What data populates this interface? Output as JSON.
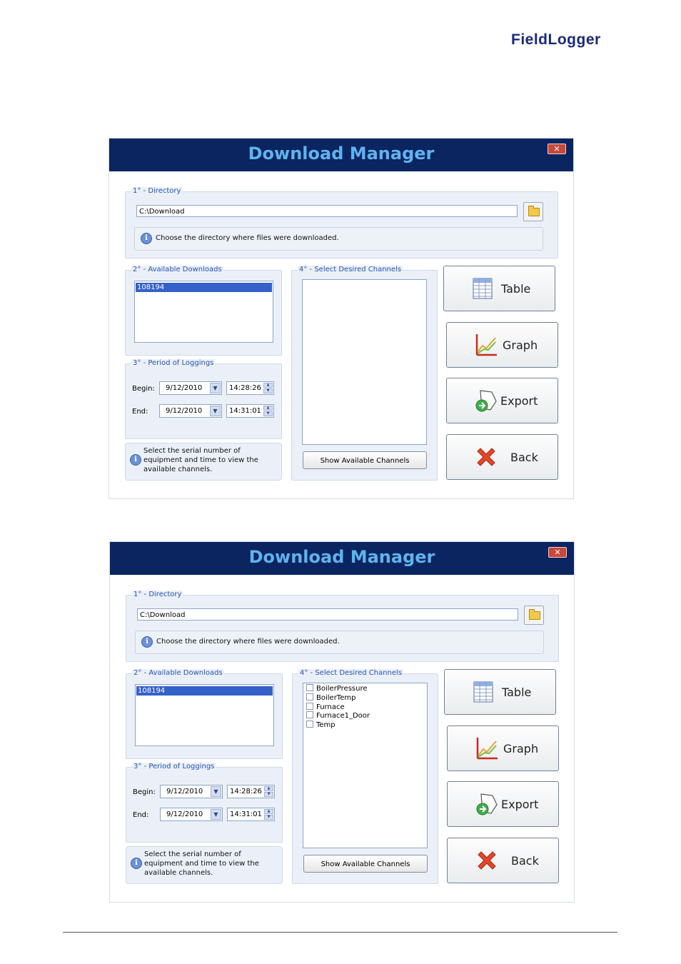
{
  "header": {
    "logo_text_bold": "FieldLogger"
  },
  "screens": [
    {
      "title": "Download Manager",
      "close_glyph": "✕",
      "directory": {
        "label": "1° - Directory",
        "path": "C:\\Download",
        "info": "Choose the directory where files were downloaded."
      },
      "downloads": {
        "label": "2° - Available Downloads",
        "items": [
          "108194"
        ]
      },
      "period": {
        "label": "3° - Period of Loggings",
        "begin_label": "Begin:",
        "begin_date": "9/12/2010",
        "begin_time": "14:28:26",
        "end_label": "End:",
        "end_date": "9/12/2010",
        "end_time": "14:31:01"
      },
      "hint": "Select the serial number of equipment and time to view the available channels.",
      "channels": {
        "label": "4° - Select Desired Channels",
        "items": [],
        "button": "Show Available Channels"
      },
      "actions": {
        "table": "Table",
        "graph": "Graph",
        "export": "Export",
        "back": "Back"
      }
    },
    {
      "title": "Download Manager",
      "close_glyph": "✕",
      "directory": {
        "label": "1° - Directory",
        "path": "C:\\Download",
        "info": "Choose the directory where files were downloaded."
      },
      "downloads": {
        "label": "2° - Available Downloads",
        "items": [
          "108194"
        ]
      },
      "period": {
        "label": "3° - Period of Loggings",
        "begin_label": "Begin:",
        "begin_date": "9/12/2010",
        "begin_time": "14:28:26",
        "end_label": "End:",
        "end_date": "9/12/2010",
        "end_time": "14:31:01"
      },
      "hint": "Select the serial number of equipment and time to view the available channels.",
      "channels": {
        "label": "4° - Select Desired Channels",
        "items": [
          "BoilerPressure",
          "BoilerTemp",
          "Furnace",
          "Furnace1_Door",
          "Temp"
        ],
        "button": "Show Available Channels"
      },
      "actions": {
        "table": "Table",
        "graph": "Graph",
        "export": "Export",
        "back": "Back"
      }
    }
  ],
  "colors": {
    "titlebar": "#0a2560",
    "title_text": "#5fb3ee",
    "group_bg": "#ebf0f8",
    "selection": "#3461c9"
  }
}
